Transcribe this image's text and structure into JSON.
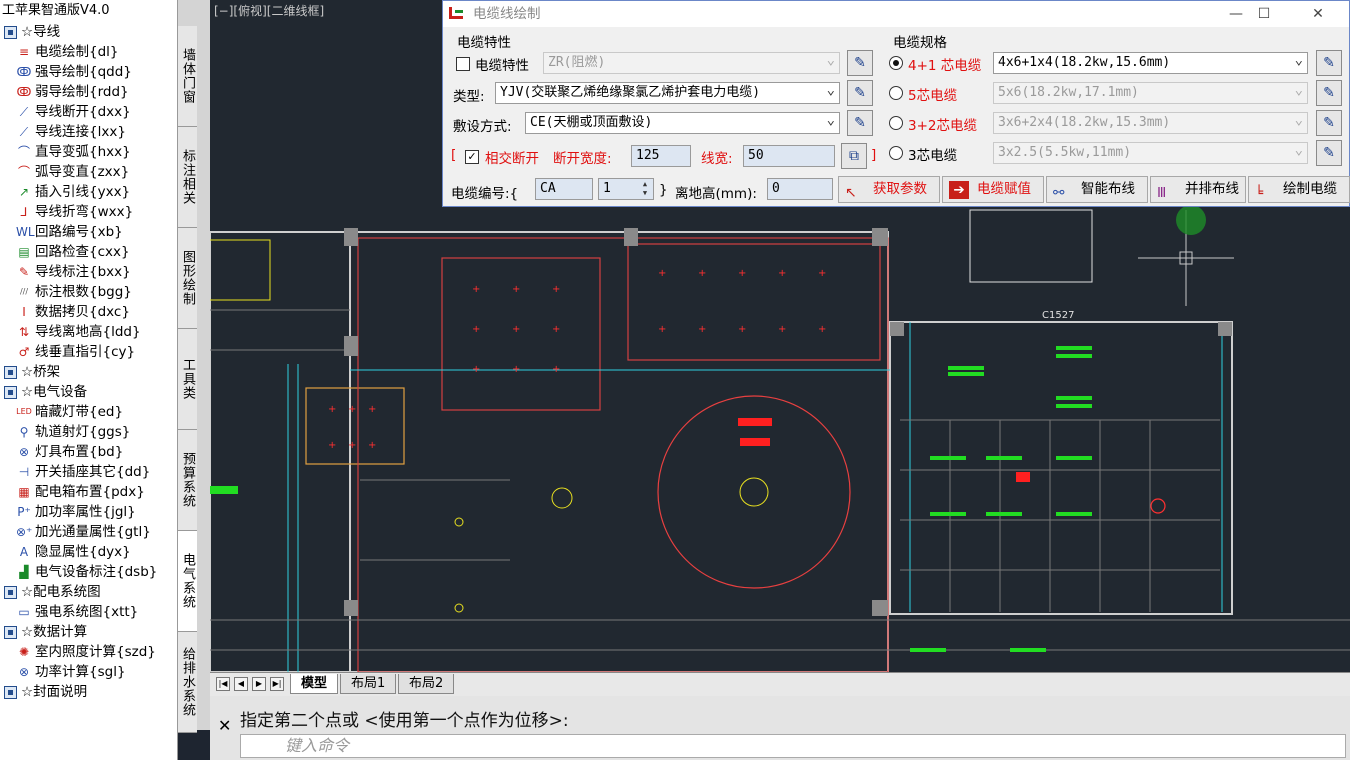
{
  "app_title": "工苹果智通版V4.0",
  "tree": [
    {
      "type": "group",
      "label": "☆导线"
    },
    {
      "type": "item",
      "icon": "cable-draw-icon",
      "glyph": "≡",
      "color": "#c8201a",
      "label": "电缆绘制{dl}"
    },
    {
      "type": "item",
      "icon": "strong-wire-icon",
      "glyph": "ↂ",
      "color": "#2a4fa8",
      "label": "强导绘制{qdd}"
    },
    {
      "type": "item",
      "icon": "weak-wire-icon",
      "glyph": "ↂ",
      "color": "#c8201a",
      "label": "弱导绘制{rdd}"
    },
    {
      "type": "item",
      "icon": "wire-break-icon",
      "glyph": "⟋",
      "color": "#2a4fa8",
      "label": "导线断开{dxx}"
    },
    {
      "type": "item",
      "icon": "wire-connect-icon",
      "glyph": "⟋",
      "color": "#2a4fa8",
      "label": "导线连接{lxx}"
    },
    {
      "type": "item",
      "icon": "straight-to-arc-icon",
      "glyph": "⌒",
      "color": "#2a4fa8",
      "label": "直导变弧{hxx}"
    },
    {
      "type": "item",
      "icon": "arc-to-straight-icon",
      "glyph": "⌒",
      "color": "#c8201a",
      "label": "弧导变直{zxx}"
    },
    {
      "type": "item",
      "icon": "leader-line-icon",
      "glyph": "↗",
      "color": "#1a8a2a",
      "label": "插入引线{yxx}"
    },
    {
      "type": "item",
      "icon": "wire-bend-icon",
      "glyph": "⅃",
      "color": "#c8201a",
      "label": "导线折弯{wxx}"
    },
    {
      "type": "item",
      "icon": "circuit-number-icon",
      "glyph": "WL",
      "color": "#2a4fa8",
      "label": "回路编号{xb}"
    },
    {
      "type": "item",
      "icon": "circuit-check-icon",
      "glyph": "▤",
      "color": "#1a8a2a",
      "label": "回路检查{cxx}"
    },
    {
      "type": "item",
      "icon": "wire-label-icon",
      "glyph": "✎",
      "color": "#c8201a",
      "label": "导线标注{bxx}"
    },
    {
      "type": "item",
      "icon": "count-label-icon",
      "glyph": "///",
      "color": "#555",
      "label": "标注根数{bgg}"
    },
    {
      "type": "item",
      "icon": "data-copy-icon",
      "glyph": "Ⅰ",
      "color": "#c8201a",
      "label": "数据拷贝{dxc}"
    },
    {
      "type": "item",
      "icon": "height-icon",
      "glyph": "⇅",
      "color": "#c8201a",
      "label": "导线离地高{ldd}"
    },
    {
      "type": "item",
      "icon": "vertical-pointer-icon",
      "glyph": "♂",
      "color": "#c8201a",
      "label": "线垂直指引{cy}"
    },
    {
      "type": "group",
      "label": "☆桥架"
    },
    {
      "type": "group",
      "label": "☆电气设备"
    },
    {
      "type": "item",
      "icon": "led-strip-icon",
      "glyph": "LED",
      "color": "#c8201a",
      "label": "暗藏灯带{ed}"
    },
    {
      "type": "item",
      "icon": "track-light-icon",
      "glyph": "⚲",
      "color": "#2a4fa8",
      "label": "轨道射灯{ggs}"
    },
    {
      "type": "item",
      "icon": "lamp-icon",
      "glyph": "⊗",
      "color": "#2a4fa8",
      "label": "灯具布置{bd}"
    },
    {
      "type": "item",
      "icon": "switch-socket-icon",
      "glyph": "⊣",
      "color": "#2a4fa8",
      "label": "开关插座其它{dd}"
    },
    {
      "type": "item",
      "icon": "distribution-box-icon",
      "glyph": "▦",
      "color": "#c8201a",
      "label": "配电箱布置{pdx}"
    },
    {
      "type": "item",
      "icon": "power-attr-icon",
      "glyph": "P⁺",
      "color": "#2a4fa8",
      "label": "加功率属性{jgl}"
    },
    {
      "type": "item",
      "icon": "lumen-attr-icon",
      "glyph": "⊗⁺",
      "color": "#2a4fa8",
      "label": "加光通量属性{gtl}"
    },
    {
      "type": "item",
      "icon": "hide-show-icon",
      "glyph": "A",
      "color": "#2a4fa8",
      "label": "隐显属性{dyx}"
    },
    {
      "type": "item",
      "icon": "device-label-icon",
      "glyph": "▟",
      "color": "#1a8a2a",
      "label": "电气设备标注{dsb}"
    },
    {
      "type": "group",
      "label": "☆配电系统图"
    },
    {
      "type": "item",
      "icon": "system-diagram-icon",
      "glyph": "▭",
      "color": "#2a4fa8",
      "label": "强电系统图{xtt}"
    },
    {
      "type": "group",
      "label": "☆数据计算"
    },
    {
      "type": "item",
      "icon": "illuminance-icon",
      "glyph": "✺",
      "color": "#c8201a",
      "label": "室内照度计算{szd}"
    },
    {
      "type": "item",
      "icon": "power-calc-icon",
      "glyph": "⊗",
      "color": "#2a4fa8",
      "label": "功率计算{sgl}"
    },
    {
      "type": "group",
      "label": "☆封面说明"
    }
  ],
  "vtabs": [
    "墙体门窗",
    "标注相关",
    "图形绘制",
    "工具类",
    "预算系统",
    "电气系统",
    "给排水系统"
  ],
  "active_vtab": 5,
  "cad": {
    "viewport_label": "[−][俯视][二维线框]",
    "text_c1527": "C1527"
  },
  "layout_tabs": [
    "模型",
    "布局1",
    "布局2"
  ],
  "active_layout": 0,
  "command": {
    "prompt": "指定第二个点或 <使用第一个点作为位移>:",
    "placeholder": "键入命令"
  },
  "dialog": {
    "title": "电缆线绘制",
    "win_min": "—",
    "win_max": "☐",
    "win_close": "✕",
    "props_group": "电缆特性",
    "spec_group": "电缆规格",
    "prop_checkbox": "电缆特性",
    "prop_value": "ZR(阻燃)",
    "type_label": "类型:",
    "type_value": "YJV(交联聚乙烯绝缘聚氯乙烯护套电力电缆)",
    "laying_label": "敷设方式:",
    "laying_value": "CE(天棚或顶面敷设)",
    "bracket_l": "[",
    "bracket_r": "]",
    "intersect_label": "相交断开",
    "gap_label": "断开宽度:",
    "gap_value": "125",
    "width_label": "线宽:",
    "width_value": "50",
    "number_label": "电缆编号:{",
    "number_prefix": "CA",
    "number_value": "1",
    "number_close": "}",
    "height_label": "离地高(mm):",
    "height_value": "0",
    "specs": [
      {
        "label": "4+1 芯电缆",
        "value": "4x6+1x4(18.2kw,15.6mm)",
        "selected": true
      },
      {
        "label": "5芯电缆",
        "value": "5x6(18.2kw,17.1mm)",
        "selected": false
      },
      {
        "label": "3+2芯电缆",
        "value": "3x6+2x4(18.2kw,15.3mm)",
        "selected": false
      },
      {
        "label": "3芯电缆",
        "value": "3x2.5(5.5kw,11mm)",
        "selected": false
      }
    ],
    "buttons": [
      "获取参数",
      "电缆赋值",
      "智能布线",
      "并排布线",
      "绘制电缆"
    ]
  },
  "colors": {
    "accent_red": "#e01010",
    "cad_bg": "#212830",
    "wall": "#c8c8c8",
    "light_red": "#ff3030",
    "fixture_green": "#22dd22"
  }
}
